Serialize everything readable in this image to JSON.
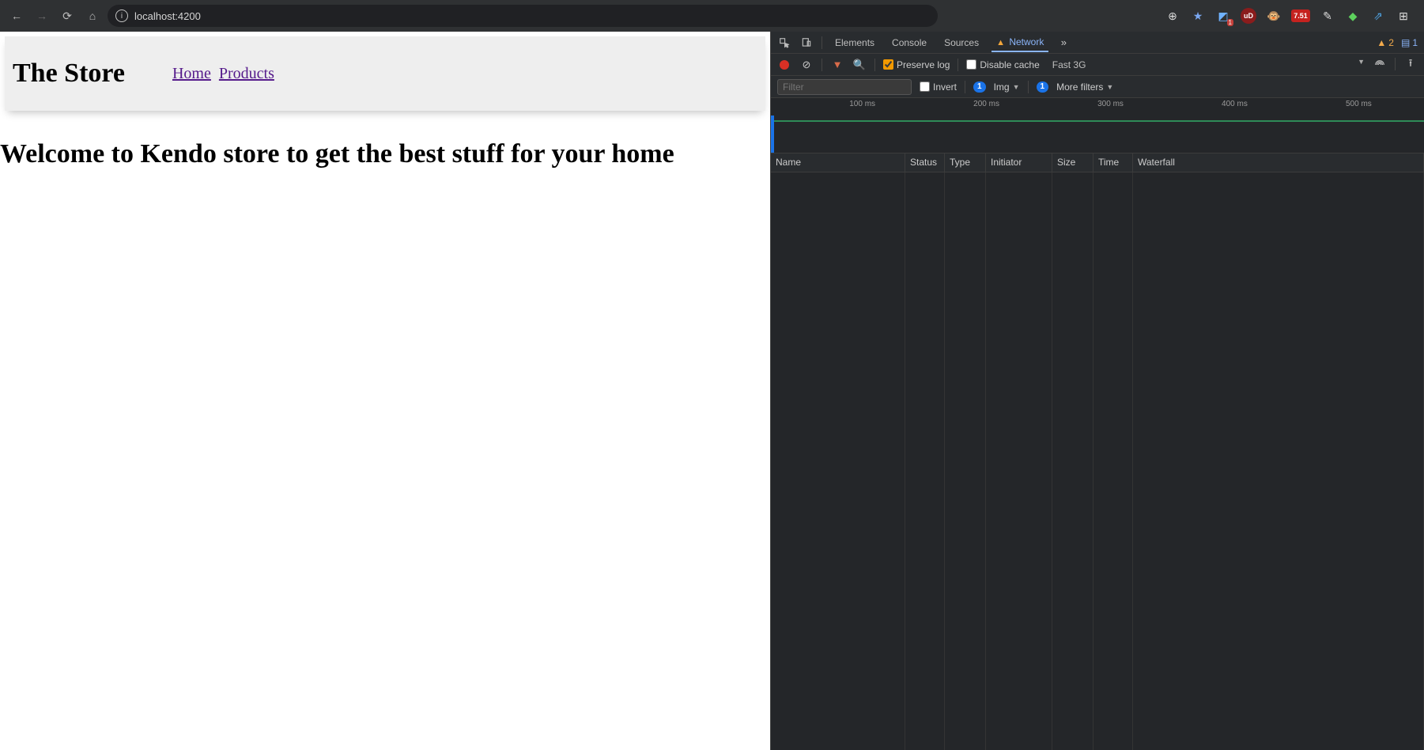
{
  "browser": {
    "url": "localhost:4200",
    "extensions_badge": "7.51"
  },
  "page": {
    "title": "The Store",
    "nav": {
      "home": "Home",
      "products": "Products"
    },
    "heading": "Welcome to Kendo store to get the best stuff for your home"
  },
  "devtools": {
    "tabs": {
      "elements": "Elements",
      "console": "Console",
      "sources": "Sources",
      "network": "Network"
    },
    "toolbar": {
      "preserve_log": "Preserve log",
      "disable_cache": "Disable cache",
      "throttle": "Fast 3G"
    },
    "filterbar": {
      "placeholder": "Filter",
      "invert": "Invert",
      "img": "Img",
      "more_filters": "More filters",
      "badge1": "1",
      "badge2": "1"
    },
    "timeline": {
      "t1": "100 ms",
      "t2": "200 ms",
      "t3": "300 ms",
      "t4": "400 ms",
      "t5": "500 ms"
    },
    "columns": {
      "name": "Name",
      "status": "Status",
      "type": "Type",
      "initiator": "Initiator",
      "size": "Size",
      "time": "Time",
      "waterfall": "Waterfall"
    },
    "counts": {
      "warnings": "2",
      "messages": "1"
    }
  }
}
